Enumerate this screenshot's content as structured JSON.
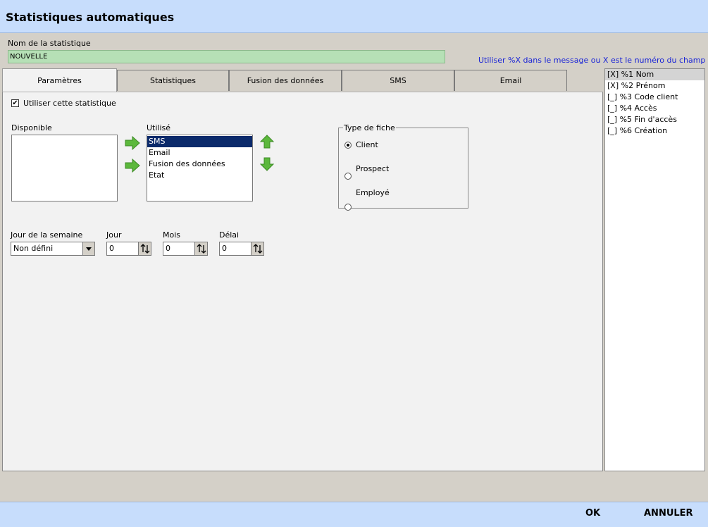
{
  "window": {
    "title": "Statistiques automatiques"
  },
  "name_field": {
    "label": "Nom de la statistique",
    "value": "NOUVELLE"
  },
  "hint": "Utiliser %X dans le message ou X est le numéro du champ",
  "tabs": [
    {
      "label": "Paramètres",
      "active": true
    },
    {
      "label": "Statistiques",
      "active": false
    },
    {
      "label": "Fusion des données",
      "active": false
    },
    {
      "label": "SMS",
      "active": false
    },
    {
      "label": "Email",
      "active": false
    }
  ],
  "params": {
    "use_checkbox": {
      "label": "Utiliser cette statistique",
      "checked": true,
      "mark": "✔"
    },
    "available": {
      "label": "Disponible",
      "items": []
    },
    "used": {
      "label": "Utilisé",
      "items": [
        "SMS",
        "Email",
        "Fusion des données",
        "Etat"
      ],
      "selected_index": 0
    },
    "card_type": {
      "legend": "Type de fiche",
      "options": [
        "Client",
        "Prospect",
        "Employé"
      ],
      "selected_index": 0
    },
    "weekday": {
      "label": "Jour de la semaine",
      "value": "Non défini"
    },
    "day": {
      "label": "Jour",
      "value": "0"
    },
    "month": {
      "label": "Mois",
      "value": "0"
    },
    "delay": {
      "label": "Délai",
      "value": "0"
    }
  },
  "fields": [
    {
      "text": "[X] %1 Nom",
      "selected": true
    },
    {
      "text": "[X] %2 Prénom",
      "selected": false
    },
    {
      "text": "[_] %3 Code client",
      "selected": false
    },
    {
      "text": "[_] %4 Accès",
      "selected": false
    },
    {
      "text": "[_] %5 Fin d'accès",
      "selected": false
    },
    {
      "text": "[_] %6 Création",
      "selected": false
    }
  ],
  "footer": {
    "ok_label": "OK",
    "cancel_label": "ANNULER"
  },
  "colors": {
    "arrow_green": "#5cb83c",
    "list_selection": "#0b2a6b",
    "hint_blue": "#1a24d6",
    "header_blue": "#c7ddfc"
  }
}
